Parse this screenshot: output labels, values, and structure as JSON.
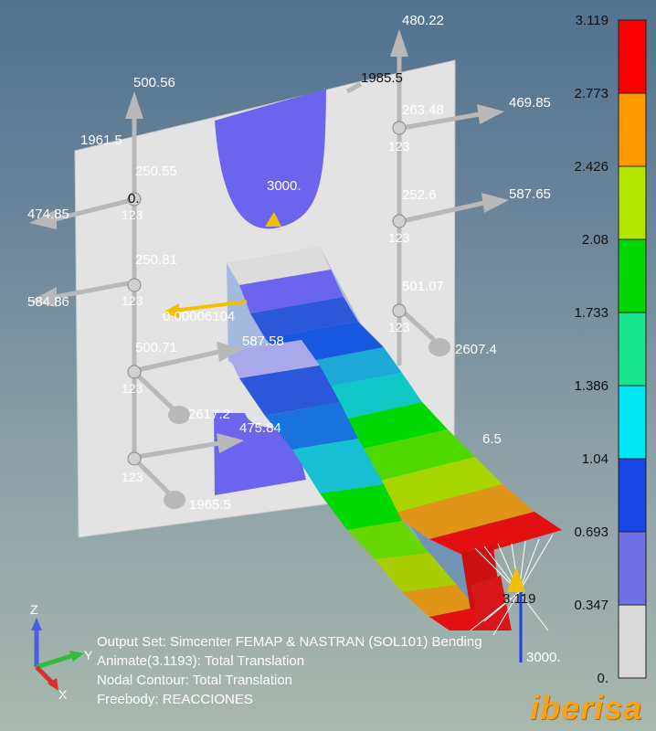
{
  "reactions": {
    "r_500_56": "500.56",
    "r_480_22": "480.22",
    "r_1985_5": "1985.5",
    "r_263_48": "263.48",
    "r_469_85": "469.85",
    "r_1961_5": "1961.5",
    "r_250_55": "250.55",
    "r_0": "0.",
    "r_3000": "3000.",
    "r_252_6": "252.6",
    "r_587_65": "587.65",
    "r_474_85": "474.85",
    "r_250_81": "250.81",
    "r_584_86": "584.86",
    "r_501_07": "501.07",
    "r_tiny": "0.00006104",
    "r_587_58": "587.58",
    "r_2607_4": "2607.4",
    "r_500_71": "500.71",
    "r_2617_2": "2617.2",
    "r_475_84": "475.84",
    "r_6_5": "6.5",
    "r_1965_5": "1965.5",
    "r_tip_3_119": "3.119",
    "r_tip_3000": "3000."
  },
  "node_id": "123",
  "legend": {
    "values": [
      "3.119",
      "2.773",
      "2.426",
      "2.08",
      "1.733",
      "1.386",
      "1.04",
      "0.693",
      "0.347",
      "0."
    ],
    "colors": [
      "#ff0000",
      "#ff9900",
      "#b2e600",
      "#00d800",
      "#19e68c",
      "#00e6f2",
      "#1a46e6",
      "#7070e6",
      "#dadada"
    ]
  },
  "axes": {
    "z": "Z",
    "y": "Y",
    "x": "X"
  },
  "info": {
    "line1": "Output Set: Simcenter FEMAP & NASTRAN (SOL101) Bending",
    "line2": "Animate(3.1193): Total Translation",
    "line3": "Nodal Contour: Total Translation",
    "line4": "Freebody: REACCIONES"
  },
  "logo": "iberisa"
}
